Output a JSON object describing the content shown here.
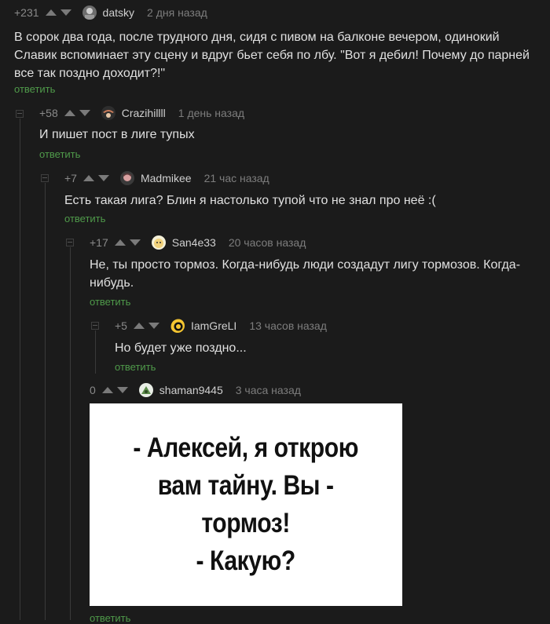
{
  "comments": [
    {
      "rating": "+231",
      "author": "datsky",
      "time": "2 дня назад",
      "text": "В сорок два года, после трудного дня, сидя с пивом на балконе вечером, одинокий Славик вспоминает эту сцену и вдруг бьет себя по лбу. \"Вот я дебил! Почему до парней все так поздно доходит?!\"",
      "reply": "ответить"
    },
    {
      "rating": "+58",
      "author": "Crazihillll",
      "time": "1 день назад",
      "text": "И пишет пост в лиге тупых",
      "reply": "ответить"
    },
    {
      "rating": "+7",
      "author": "Madmikee",
      "time": "21 час назад",
      "text": "Есть такая лига? Блин я настолько тупой что не знал про неё :(",
      "reply": "ответить"
    },
    {
      "rating": "+17",
      "author": "San4e33",
      "time": "20 часов назад",
      "text": "Не, ты просто тормоз. Когда-нибудь люди создадут лигу тормозов. Когда-нибудь.",
      "reply": "ответить"
    },
    {
      "rating": "+5",
      "author": "IamGreLI",
      "time": "13 часов назад",
      "text": "Но будет уже поздно...",
      "reply": "ответить"
    },
    {
      "rating": "0",
      "author": "shaman9445",
      "time": "3 часа назад",
      "image_text": "- Алексей, я открою\nвам тайну. Вы -\nтормоз!\n- Какую?",
      "reply": "ответить"
    }
  ],
  "colors": {
    "background": "#1b1b1b",
    "reply_link": "#4f9a4a",
    "meta": "#7d7d7d"
  }
}
